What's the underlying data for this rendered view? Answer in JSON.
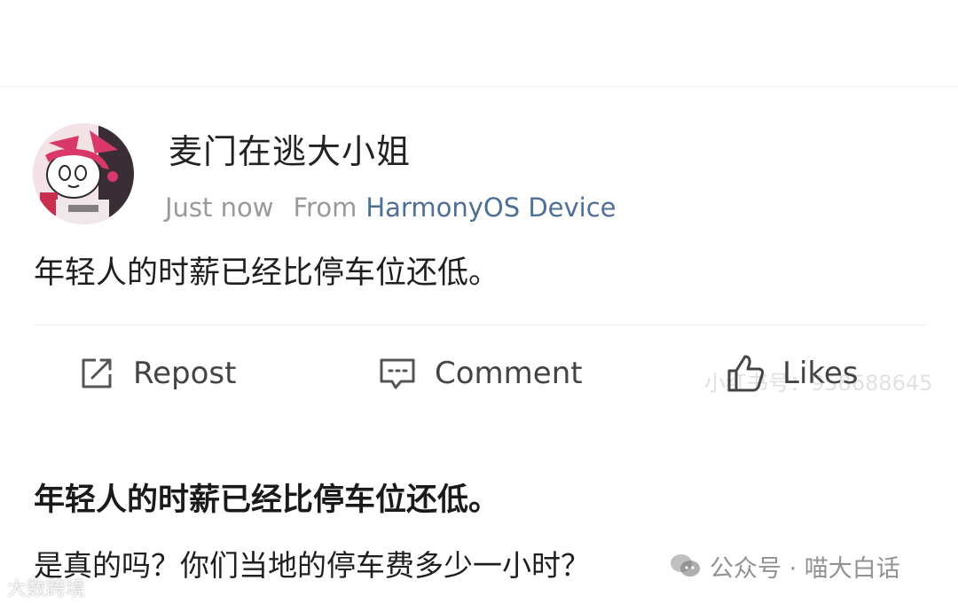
{
  "post": {
    "username": "麦门在逃大小姐",
    "time": "Just now",
    "from_label": "From",
    "device": "HarmonyOS Device",
    "text": "年轻人的时薪已经比停车位还低。",
    "avatar_icon": "cartoon-avatar"
  },
  "actions": {
    "repost": {
      "label": "Repost",
      "icon": "repost-icon"
    },
    "comment": {
      "label": "Comment",
      "icon": "comment-icon"
    },
    "likes": {
      "label": "Likes",
      "icon": "thumbs-up-icon"
    }
  },
  "article": {
    "title": "年轻人的时薪已经比停车位还低。",
    "subtitle": "是真的吗？你们当地的停车费多少一小时？"
  },
  "watermarks": {
    "account": "公众号 · 喵大白话",
    "faint_id": "小红书号：958688645",
    "bottom_left": "大数跨境"
  },
  "colors": {
    "device_link": "#4e6f96",
    "meta_gray": "#9a9a9a",
    "text": "#1f1f1f"
  }
}
